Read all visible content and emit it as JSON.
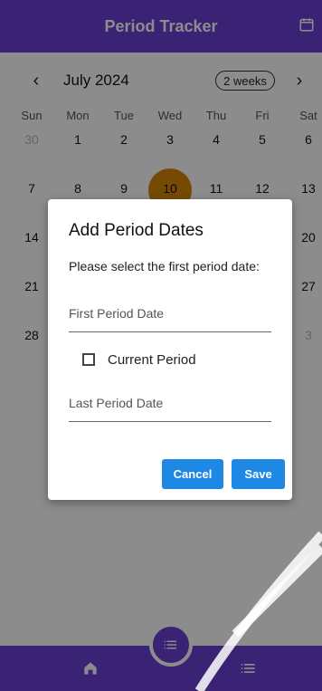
{
  "app": {
    "title": "Period Tracker",
    "appbar_icon": "calendar-icon"
  },
  "calendar": {
    "month_label": "July 2024",
    "range_button": "2 weeks",
    "prev_icon": "chevron-left-icon",
    "next_icon": "chevron-right-icon",
    "weekdays": [
      "Sun",
      "Mon",
      "Tue",
      "Wed",
      "Thu",
      "Fri",
      "Sat"
    ],
    "weeks": [
      [
        "30",
        "1",
        "2",
        "3",
        "4",
        "5",
        "6"
      ],
      [
        "7",
        "8",
        "9",
        "10",
        "11",
        "12",
        "13"
      ],
      [
        "14",
        "",
        "",
        "",
        "",
        "",
        "20"
      ],
      [
        "21",
        "",
        "",
        "",
        "",
        "",
        "27"
      ],
      [
        "28",
        "",
        "",
        "",
        "",
        "",
        "3"
      ]
    ],
    "selected_day": "10",
    "highlight_color": "#d8880a"
  },
  "dialog": {
    "title": "Add Period Dates",
    "subtitle": "Please select the first period date:",
    "first_period_date_label": "First Period Date",
    "current_period_label": "Current Period",
    "current_period_checked": false,
    "last_period_date_label": "Last Period Date",
    "cancel_label": "Cancel",
    "save_label": "Save"
  },
  "bottom_nav": {
    "home_icon": "home-icon",
    "fab_icon": "list-icon",
    "list_icon": "list-icon"
  },
  "colors": {
    "primary": "#6a3fd6",
    "button": "#1e88e5",
    "scrim": "rgba(0,0,0,0.45)"
  }
}
